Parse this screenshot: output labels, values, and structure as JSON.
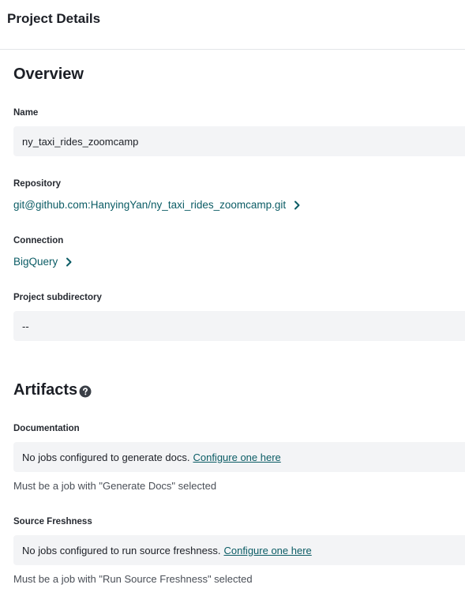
{
  "header": {
    "title": "Project Details"
  },
  "overview": {
    "title": "Overview",
    "name": {
      "label": "Name",
      "value": "ny_taxi_rides_zoomcamp"
    },
    "repository": {
      "label": "Repository",
      "value": "git@github.com:HanyingYan/ny_taxi_rides_zoomcamp.git"
    },
    "connection": {
      "label": "Connection",
      "value": "BigQuery"
    },
    "subdirectory": {
      "label": "Project subdirectory",
      "value": "--"
    }
  },
  "artifacts": {
    "title": "Artifacts",
    "help_icon": "question-circle-icon",
    "documentation": {
      "label": "Documentation",
      "message": "No jobs configured to generate docs.",
      "link": "Configure one here",
      "helper": "Must be a job with \"Generate Docs\" selected"
    },
    "freshness": {
      "label": "Source Freshness",
      "message": "No jobs configured to run source freshness.",
      "link": "Configure one here",
      "helper": "Must be a job with \"Run Source Freshness\" selected"
    }
  },
  "colors": {
    "link": "#0b5c65",
    "field_bg": "#f3f4f6",
    "divider": "#e3e5e8"
  }
}
